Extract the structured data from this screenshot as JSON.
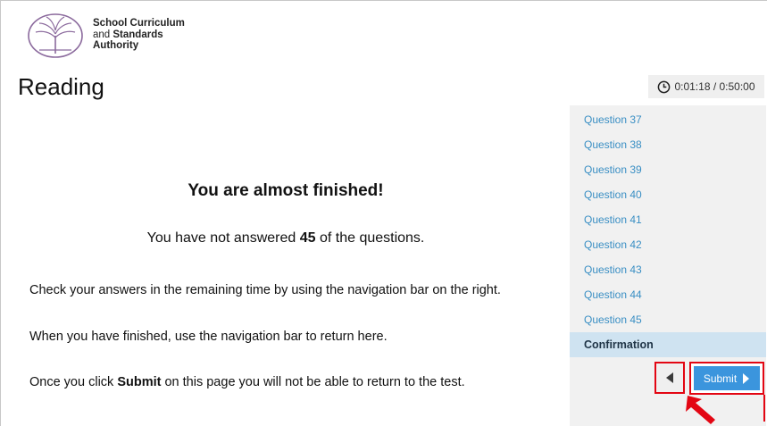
{
  "brand": {
    "line1": "School Curriculum",
    "line2_prefix": "and ",
    "line2_bold": "Standards",
    "line3": "Authority"
  },
  "page_title": "Reading",
  "timer": {
    "icon": "clock-icon",
    "text": "0:01:18 / 0:50:00"
  },
  "main": {
    "heading": "You are almost finished!",
    "unanswered_prefix": "You have not answered ",
    "unanswered_count": "45",
    "unanswered_suffix": " of the questions.",
    "check_text": "Check your answers in the remaining time by using the navigation bar on the right.",
    "return_text": "When you have finished, use the navigation bar to return here.",
    "submit_note_prefix": "Once you click ",
    "submit_note_bold": "Submit",
    "submit_note_suffix": " on this page you will not be able to return to the test."
  },
  "nav": {
    "items": [
      "Question 37",
      "Question 38",
      "Question 39",
      "Question 40",
      "Question 41",
      "Question 42",
      "Question 43",
      "Question 44",
      "Question 45",
      "Confirmation"
    ],
    "active": "Confirmation"
  },
  "buttons": {
    "back_icon": "triangle-left-icon",
    "submit_label": "Submit",
    "submit_icon": "triangle-right-icon"
  },
  "colors": {
    "nav_link": "#3a8fc4",
    "active_bg": "#cfe3f1",
    "submit_bg": "#3b95dd",
    "highlight": "#e30613"
  }
}
